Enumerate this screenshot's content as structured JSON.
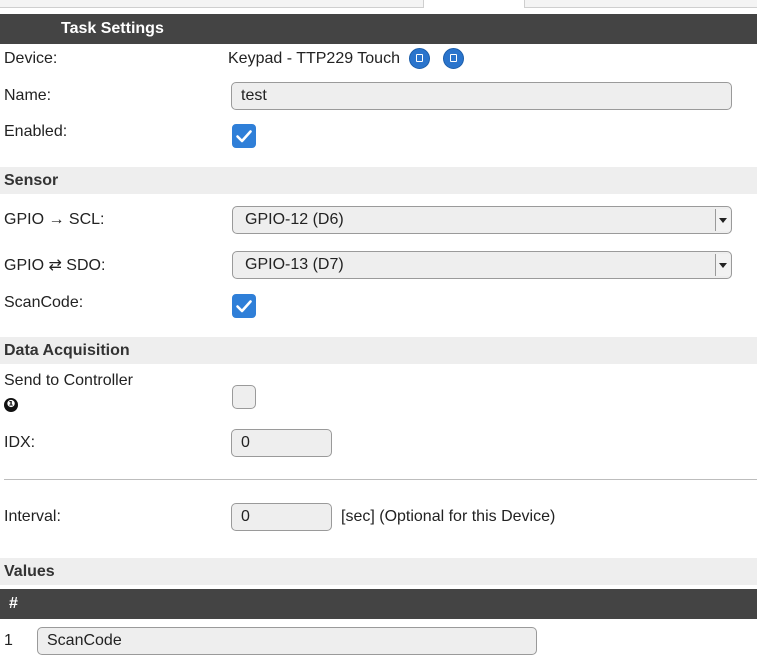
{
  "task_settings": {
    "header": "Task Settings",
    "device_label": "Device:",
    "device_value": "Keypad - TTP229 Touch",
    "name_label": "Name:",
    "name_value": "test",
    "enabled_label": "Enabled:",
    "enabled": true
  },
  "sensor": {
    "header": "Sensor",
    "scl_label": "GPIO → SCL:",
    "scl_value": "GPIO-12 (D6)",
    "sdo_label": "GPIO ⇄ SDO:",
    "sdo_value": "GPIO-13 (D7)",
    "scancode_label": "ScanCode:",
    "scancode": true
  },
  "data_acquisition": {
    "header": "Data Acquisition",
    "send_label": "Send to Controller",
    "send_marker": "❶",
    "send": false,
    "idx_label": "IDX:",
    "idx_value": "0",
    "interval_label": "Interval:",
    "interval_value": "0",
    "interval_note": "[sec] (Optional for this Device)"
  },
  "values": {
    "header": "Values",
    "table_header": "#",
    "rows": [
      {
        "index": "1",
        "name": "ScanCode"
      }
    ]
  },
  "colors": {
    "header_bg": "#444444",
    "section_bg": "#eeeeee",
    "accent": "#2f7fd8"
  },
  "icons": {
    "device_buttons": [
      "info-icon",
      "info-icon"
    ],
    "send_marker": "numbered-circle-icon"
  }
}
